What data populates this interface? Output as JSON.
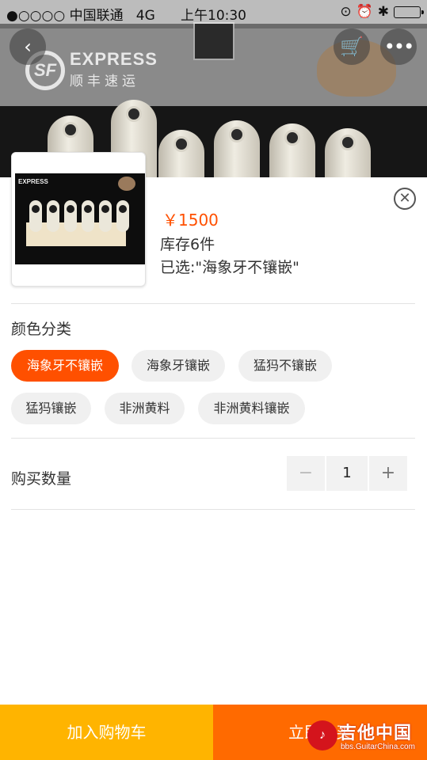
{
  "status_bar": {
    "carrier": "●○○○○ 中国联通",
    "network": "4G",
    "time": "上午10:30"
  },
  "banner": {
    "brand_en": "EXPRESS",
    "brand_cn": "顺丰速运",
    "logo_text": "SF"
  },
  "nav": {
    "back_icon": "chevron-left-icon",
    "cart_icon": "cart-icon",
    "more_icon": "more-icon"
  },
  "sku": {
    "price": "￥1500",
    "stock": "库存6件",
    "selected": "已选:\"海象牙不镶嵌\""
  },
  "color_section": {
    "title": "颜色分类",
    "options": [
      {
        "label": "海象牙不镶嵌",
        "selected": true
      },
      {
        "label": "海象牙镶嵌",
        "selected": false
      },
      {
        "label": "猛犸不镶嵌",
        "selected": false
      },
      {
        "label": "猛犸镶嵌",
        "selected": false
      },
      {
        "label": "非洲黄料",
        "selected": false
      },
      {
        "label": "非洲黄料镶嵌",
        "selected": false
      }
    ]
  },
  "quantity": {
    "label": "购买数量",
    "value": "1",
    "minus": "−",
    "plus": "+"
  },
  "bottom_bar": {
    "add_to_cart": "加入购物车",
    "buy_now": "立即购买"
  },
  "watermark": {
    "title": "吉他中国",
    "url": "bbs.GuitarChina.com"
  },
  "colors": {
    "accent": "#ff5000",
    "cart_button": "#ffb400",
    "buy_button": "#ff6a00",
    "option_bg": "#f0f0f0"
  }
}
